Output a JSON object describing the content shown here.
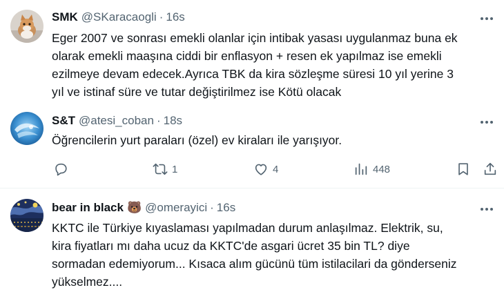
{
  "tweets": [
    {
      "name": "SMK",
      "handle": "@SKaracaogli",
      "time": "16s",
      "lines": [
        "Eger 2007 ve sonrası emekli olanlar için intibak yasası uygulanmaz buna ek",
        "olarak emekli maaşına ciddi bir enflasyon + resen ek yapılmaz ise emekli",
        "ezilmeye devam edecek.Ayrıca TBK da kira sözleşme süresi 10 yıl yerine 3",
        "yıl ve istinaf süre ve tutar değiştirilmez ise Kötü olacak"
      ],
      "avatar_icon": "cat-photo-avatar"
    },
    {
      "name": "S&T",
      "handle": "@atesi_coban",
      "time": "18s",
      "lines": [
        "Öğrencilerin yurt paraları (özel) ev kiraları ile yarışıyor."
      ],
      "avatar_icon": "blue-swirl-avatar",
      "actions": {
        "reply_count": "",
        "retweet_count": "1",
        "like_count": "4",
        "views_count": "448"
      }
    },
    {
      "name": "bear in black",
      "emoji": "🐻",
      "handle": "@omerayici",
      "time": "16s",
      "lines": [
        "KKTC ile Türkiye kıyaslaması yapılmadan durum anlaşılmaz. Elektrik, su,",
        "kira fiyatları mı daha ucuz da KKTC'de asgari ücret 35 bin TL? diye",
        "sormadan edemiyorum... Kısaca alım gücünü tüm istilacilari da gönderseniz",
        "yükselmez...."
      ],
      "avatar_icon": "starry-night-avatar"
    }
  ],
  "separator": "·",
  "colors": {
    "text": "#0f1419",
    "secondary": "#536471",
    "divider": "#eff3f4"
  }
}
